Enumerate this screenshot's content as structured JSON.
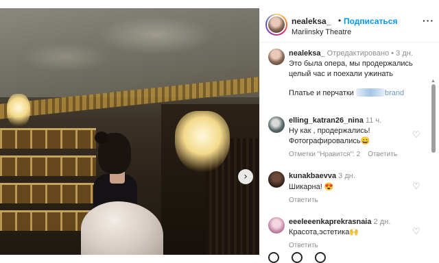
{
  "header": {
    "username": "nealeksa_",
    "separator": "•",
    "follow_label": "Подписаться",
    "location": "Mariinsky Theatre",
    "more_icon": "more-horizontal-icon",
    "more_label": "···"
  },
  "photo": {
    "next_arrow": "›"
  },
  "caption": {
    "username": "nealeksa_",
    "edited": "Отредактировано",
    "dot": "•",
    "time": "3 дн.",
    "line1": "Это была опера, мы продержались",
    "line2": "целый час и поехали ужинать",
    "line3_prefix": "Платье и перчатки",
    "line3_suffix": "brand"
  },
  "comments": [
    {
      "username": "elling_katran26_nina",
      "time": "11 ч.",
      "line1": "Ну как , продержались!",
      "line2": "Фотографировались😄",
      "likes": "Отметки \"Нравится\": 2",
      "reply": "Ответить"
    },
    {
      "username": "kunakbaevva",
      "time": "3 дн.",
      "line1": "Шикарна! 😍",
      "reply": "Ответить"
    },
    {
      "username": "eeeleeenkaprekrasnaia",
      "time": "2 дн.",
      "line1": "Красота,эстетика🙌",
      "reply": "Ответить"
    }
  ],
  "icons": {
    "heart": "♡",
    "scroll_up": "▲",
    "scroll_down": "▼"
  },
  "colors": {
    "accent": "#0095f6",
    "muted": "#8e8e8e",
    "text": "#262626"
  }
}
